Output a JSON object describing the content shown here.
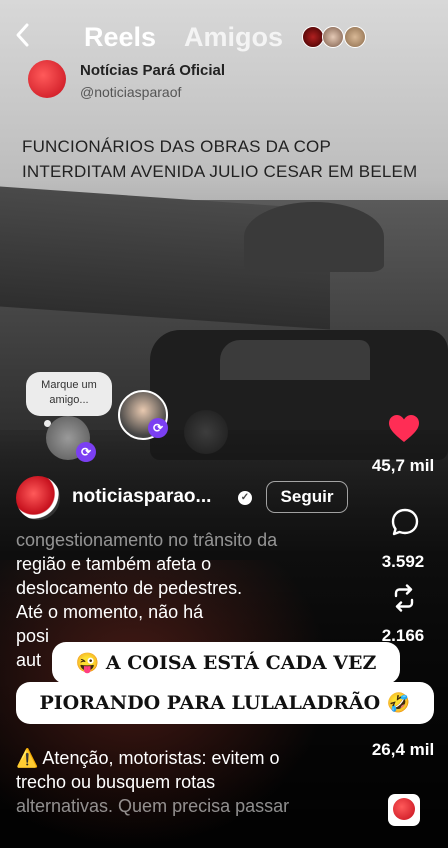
{
  "topbar": {
    "back_icon": "chevron-left-icon",
    "tab_reels": "Reels",
    "tab_amigos": "Amigos"
  },
  "tweet": {
    "name": "Notícias Pará Oficial",
    "handle": "@noticiasparaof",
    "text_line1": "FUNCIONÁRIOS DAS OBRAS DA COP",
    "text_line2": "INTERDITAM AVENIDA JULIO CESAR EM BELEM"
  },
  "friends": {
    "bubble_line1": "Marque um",
    "bubble_line2": "amigo...",
    "repost_icon": "repost-icon"
  },
  "account": {
    "name": "noticiasparao...",
    "follow_label": "Seguir"
  },
  "caption": {
    "line1": "congestionamento no trânsito da",
    "line2": "região e também afeta o",
    "line3": "deslocamento de pedestres.",
    "line4": "Até o momento, não há",
    "line5": "posi",
    "line6": "aut",
    "line7": "⚠️ Atenção, motoristas: evitem o",
    "line8": "trecho ou busquem rotas",
    "line9": "alternativas. Quem precisa passar"
  },
  "banner": {
    "line1": "😜 A COISA ESTÁ CADA VEZ",
    "line2": "PIORANDO PARA LULALADRÃO 🤣"
  },
  "rail": {
    "likes": "45,7 mil",
    "comments": "3.592",
    "reposts": "2.166",
    "shares": "26,4 mil",
    "like_color": "#ff2d55"
  }
}
